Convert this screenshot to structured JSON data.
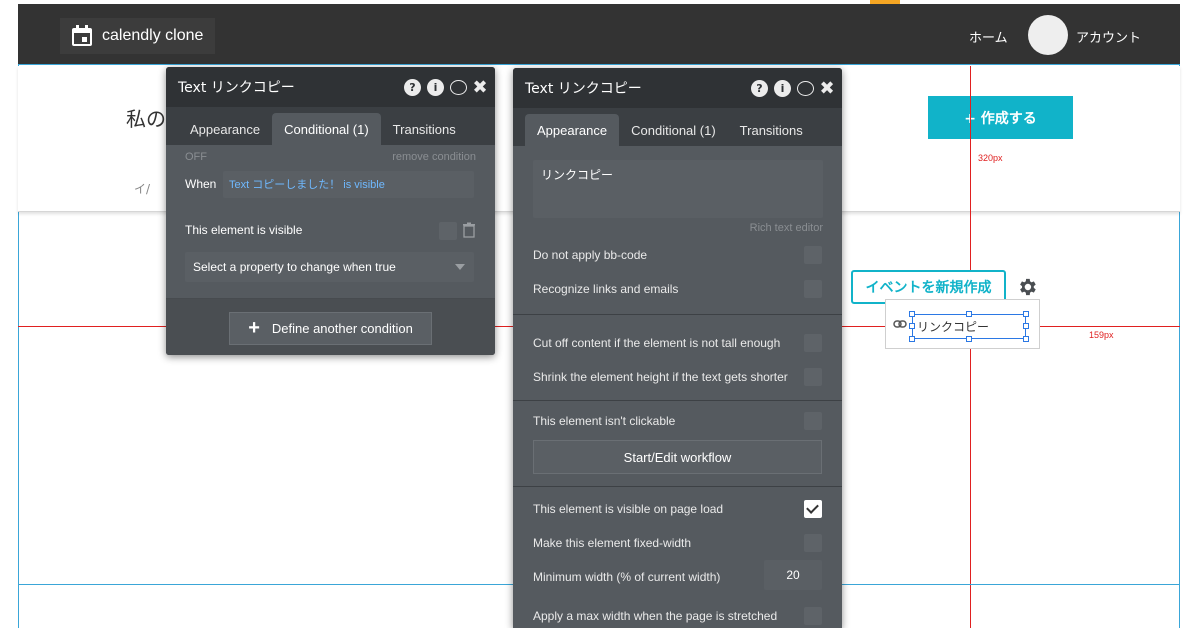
{
  "app": {
    "logo_text": "calendly clone",
    "nav_home": "ホーム",
    "nav_account": "アカウント"
  },
  "page": {
    "heading": "私の",
    "subtext": "イ/",
    "create_button": "+ 作成する",
    "label_320": "320px",
    "label_159": "159px",
    "event_button": "イベントを新規作成",
    "copy_text": "リンクコピー"
  },
  "left_panel": {
    "title": "Text リンクコピー",
    "tabs": [
      "Appearance",
      "Conditional (1)",
      "Transitions"
    ],
    "off_label": "OFF",
    "remove_condition": "remove condition",
    "when_label": "When",
    "when_expression": "Text コピーしました！ is visible",
    "visible_label": "This element is visible",
    "property_select": "Select a property to change when true",
    "define_button": "Define another condition"
  },
  "right_panel": {
    "title": "Text リンクコピー",
    "tabs": [
      "Appearance",
      "Conditional (1)",
      "Transitions"
    ],
    "text_content": "リンクコピー",
    "rich_text_editor": "Rich text editor",
    "opt_bbcode": "Do not apply bb-code",
    "opt_links": "Recognize links and emails",
    "opt_cutoff": "Cut off content if the element is not tall enough",
    "opt_shrink": "Shrink the element height if the text gets shorter",
    "opt_clickable": "This element isn't clickable",
    "workflow_button": "Start/Edit workflow",
    "opt_visible_load": "This element is visible on page load",
    "opt_fixed_width": "Make this element fixed-width",
    "min_width_label": "Minimum width (% of current width)",
    "min_width_value": "20",
    "opt_max_width": "Apply a max width when the page is stretched"
  },
  "colors": {
    "accent": "#11b3c9",
    "topbar": "#333333",
    "panel": "#4a4e52",
    "guide": "#e02020",
    "selection": "#2b78e4"
  },
  "icons": [
    "calendar-icon",
    "help-icon",
    "info-icon",
    "comment-icon",
    "close-icon",
    "gear-icon",
    "link-icon",
    "plus-icon",
    "trash-icon",
    "chevron-down-icon",
    "checkmark-icon"
  ]
}
